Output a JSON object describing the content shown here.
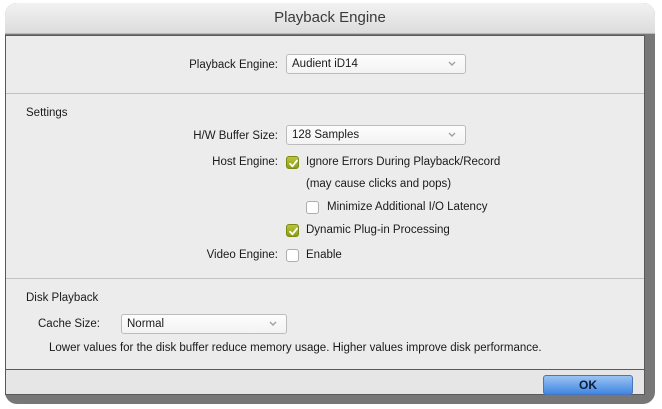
{
  "window": {
    "title": "Playback Engine"
  },
  "playback_engine": {
    "label": "Playback Engine:",
    "value": "Audient iD14"
  },
  "settings": {
    "heading": "Settings",
    "hw_buffer": {
      "label": "H/W Buffer Size:",
      "value": "128 Samples"
    },
    "host_engine": {
      "label": "Host Engine:",
      "ignore_errors": {
        "label": "Ignore Errors During Playback/Record",
        "checked": true
      },
      "note": "(may cause clicks and pops)",
      "minimize_latency": {
        "label": "Minimize Additional I/O Latency",
        "checked": false
      },
      "dynamic_plugin": {
        "label": "Dynamic Plug-in Processing",
        "checked": true
      }
    },
    "video_engine": {
      "label": "Video Engine:",
      "enable": {
        "label": "Enable",
        "checked": false
      }
    }
  },
  "disk_playback": {
    "heading": "Disk Playback",
    "cache_size": {
      "label": "Cache Size:",
      "value": "Normal"
    },
    "note": "Lower values for the disk buffer reduce memory usage.  Higher values improve disk performance."
  },
  "buttons": {
    "ok": "OK"
  },
  "colors": {
    "checkbox_checked": "#9aa727",
    "ok_button": "#5f9ae8",
    "window_frame": "#777777"
  },
  "icons": [
    "popup-arrow-icon",
    "checkmark-icon"
  ]
}
